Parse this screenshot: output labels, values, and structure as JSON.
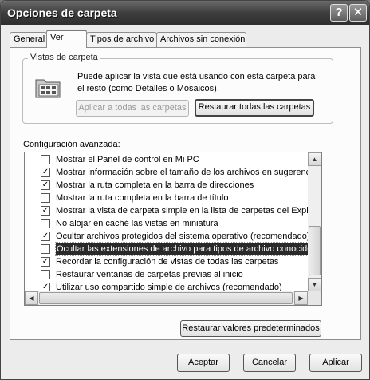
{
  "window": {
    "title": "Opciones de carpeta"
  },
  "tabs": [
    {
      "label": "General"
    },
    {
      "label": "Ver"
    },
    {
      "label": "Tipos de archivo"
    },
    {
      "label": "Archivos sin conexión"
    }
  ],
  "folder_views": {
    "legend": "Vistas de carpeta",
    "description": "Puede aplicar la vista que está usando con esta carpeta para el resto (como Detalles o Mosaicos).",
    "apply_all_label": "Aplicar a todas las carpetas",
    "reset_all_label": "Restaurar todas las carpetas"
  },
  "advanced": {
    "label": "Configuración avanzada:",
    "items": [
      {
        "label": "Mostrar el Panel de control en Mi PC",
        "checked": false
      },
      {
        "label": "Mostrar información sobre el tamaño de los archivos en sugerencias de carpeta",
        "checked": true
      },
      {
        "label": "Mostrar la ruta completa en la barra de direcciones",
        "checked": true
      },
      {
        "label": "Mostrar la ruta completa en la barra de título",
        "checked": false
      },
      {
        "label": "Mostrar la vista de carpeta simple en la lista de carpetas del Explorador",
        "checked": true
      },
      {
        "label": "No alojar en caché las vistas en miniatura",
        "checked": false
      },
      {
        "label": "Ocultar archivos protegidos del sistema operativo (recomendado)",
        "checked": true
      },
      {
        "label": "Ocultar las extensiones de archivo para tipos de archivo conocidos",
        "checked": false,
        "selected": true
      },
      {
        "label": "Recordar la configuración de vistas de todas las carpetas",
        "checked": true
      },
      {
        "label": "Restaurar ventanas de carpetas previas al inicio",
        "checked": false
      },
      {
        "label": "Utilizar uso compartido simple de archivos (recomendado)",
        "checked": true
      }
    ],
    "restore_defaults_label": "Restaurar valores predeterminados"
  },
  "footer": {
    "accept_label": "Aceptar",
    "cancel_label": "Cancelar",
    "apply_label": "Aplicar"
  },
  "icons": {
    "help": "help-icon",
    "close": "close-icon",
    "folder_view": "folder-view-icon",
    "check": "check-icon"
  }
}
